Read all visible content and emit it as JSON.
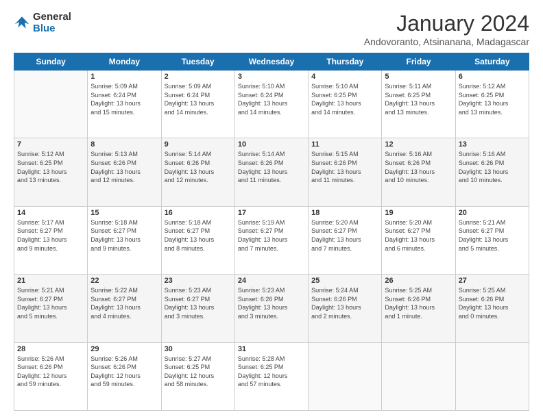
{
  "logo": {
    "line1": "General",
    "line2": "Blue"
  },
  "title": "January 2024",
  "subtitle": "Andovoranto, Atsinanana, Madagascar",
  "headers": [
    "Sunday",
    "Monday",
    "Tuesday",
    "Wednesday",
    "Thursday",
    "Friday",
    "Saturday"
  ],
  "weeks": [
    [
      {
        "day": "",
        "info": ""
      },
      {
        "day": "1",
        "info": "Sunrise: 5:09 AM\nSunset: 6:24 PM\nDaylight: 13 hours\nand 15 minutes."
      },
      {
        "day": "2",
        "info": "Sunrise: 5:09 AM\nSunset: 6:24 PM\nDaylight: 13 hours\nand 14 minutes."
      },
      {
        "day": "3",
        "info": "Sunrise: 5:10 AM\nSunset: 6:24 PM\nDaylight: 13 hours\nand 14 minutes."
      },
      {
        "day": "4",
        "info": "Sunrise: 5:10 AM\nSunset: 6:25 PM\nDaylight: 13 hours\nand 14 minutes."
      },
      {
        "day": "5",
        "info": "Sunrise: 5:11 AM\nSunset: 6:25 PM\nDaylight: 13 hours\nand 13 minutes."
      },
      {
        "day": "6",
        "info": "Sunrise: 5:12 AM\nSunset: 6:25 PM\nDaylight: 13 hours\nand 13 minutes."
      }
    ],
    [
      {
        "day": "7",
        "info": "Sunrise: 5:12 AM\nSunset: 6:25 PM\nDaylight: 13 hours\nand 13 minutes."
      },
      {
        "day": "8",
        "info": "Sunrise: 5:13 AM\nSunset: 6:26 PM\nDaylight: 13 hours\nand 12 minutes."
      },
      {
        "day": "9",
        "info": "Sunrise: 5:14 AM\nSunset: 6:26 PM\nDaylight: 13 hours\nand 12 minutes."
      },
      {
        "day": "10",
        "info": "Sunrise: 5:14 AM\nSunset: 6:26 PM\nDaylight: 13 hours\nand 11 minutes."
      },
      {
        "day": "11",
        "info": "Sunrise: 5:15 AM\nSunset: 6:26 PM\nDaylight: 13 hours\nand 11 minutes."
      },
      {
        "day": "12",
        "info": "Sunrise: 5:16 AM\nSunset: 6:26 PM\nDaylight: 13 hours\nand 10 minutes."
      },
      {
        "day": "13",
        "info": "Sunrise: 5:16 AM\nSunset: 6:26 PM\nDaylight: 13 hours\nand 10 minutes."
      }
    ],
    [
      {
        "day": "14",
        "info": "Sunrise: 5:17 AM\nSunset: 6:27 PM\nDaylight: 13 hours\nand 9 minutes."
      },
      {
        "day": "15",
        "info": "Sunrise: 5:18 AM\nSunset: 6:27 PM\nDaylight: 13 hours\nand 9 minutes."
      },
      {
        "day": "16",
        "info": "Sunrise: 5:18 AM\nSunset: 6:27 PM\nDaylight: 13 hours\nand 8 minutes."
      },
      {
        "day": "17",
        "info": "Sunrise: 5:19 AM\nSunset: 6:27 PM\nDaylight: 13 hours\nand 7 minutes."
      },
      {
        "day": "18",
        "info": "Sunrise: 5:20 AM\nSunset: 6:27 PM\nDaylight: 13 hours\nand 7 minutes."
      },
      {
        "day": "19",
        "info": "Sunrise: 5:20 AM\nSunset: 6:27 PM\nDaylight: 13 hours\nand 6 minutes."
      },
      {
        "day": "20",
        "info": "Sunrise: 5:21 AM\nSunset: 6:27 PM\nDaylight: 13 hours\nand 5 minutes."
      }
    ],
    [
      {
        "day": "21",
        "info": "Sunrise: 5:21 AM\nSunset: 6:27 PM\nDaylight: 13 hours\nand 5 minutes."
      },
      {
        "day": "22",
        "info": "Sunrise: 5:22 AM\nSunset: 6:27 PM\nDaylight: 13 hours\nand 4 minutes."
      },
      {
        "day": "23",
        "info": "Sunrise: 5:23 AM\nSunset: 6:27 PM\nDaylight: 13 hours\nand 3 minutes."
      },
      {
        "day": "24",
        "info": "Sunrise: 5:23 AM\nSunset: 6:26 PM\nDaylight: 13 hours\nand 3 minutes."
      },
      {
        "day": "25",
        "info": "Sunrise: 5:24 AM\nSunset: 6:26 PM\nDaylight: 13 hours\nand 2 minutes."
      },
      {
        "day": "26",
        "info": "Sunrise: 5:25 AM\nSunset: 6:26 PM\nDaylight: 13 hours\nand 1 minute."
      },
      {
        "day": "27",
        "info": "Sunrise: 5:25 AM\nSunset: 6:26 PM\nDaylight: 13 hours\nand 0 minutes."
      }
    ],
    [
      {
        "day": "28",
        "info": "Sunrise: 5:26 AM\nSunset: 6:26 PM\nDaylight: 12 hours\nand 59 minutes."
      },
      {
        "day": "29",
        "info": "Sunrise: 5:26 AM\nSunset: 6:26 PM\nDaylight: 12 hours\nand 59 minutes."
      },
      {
        "day": "30",
        "info": "Sunrise: 5:27 AM\nSunset: 6:25 PM\nDaylight: 12 hours\nand 58 minutes."
      },
      {
        "day": "31",
        "info": "Sunrise: 5:28 AM\nSunset: 6:25 PM\nDaylight: 12 hours\nand 57 minutes."
      },
      {
        "day": "",
        "info": ""
      },
      {
        "day": "",
        "info": ""
      },
      {
        "day": "",
        "info": ""
      }
    ]
  ]
}
